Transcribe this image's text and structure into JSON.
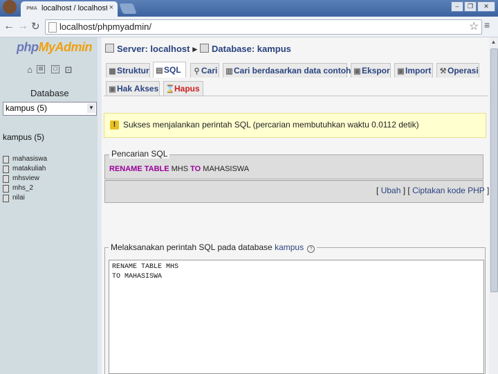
{
  "browser": {
    "tab_title": "localhost / localhost / kampus",
    "tab_favicon": "PMA",
    "tab_close": "×",
    "url": "localhost/phpmyadmin/",
    "window_buttons": [
      "–",
      "❐",
      "✕"
    ]
  },
  "logo": {
    "php": "php",
    "my": "My",
    "admin": "Admin"
  },
  "left": {
    "database_label": "Database",
    "database_selected": "kampus (5)",
    "db_heading": "kampus (5)",
    "tables": [
      "mahasiswa",
      "matakuliah",
      "mhsview",
      "mhs_2",
      "nilai"
    ]
  },
  "breadcrumb": {
    "server": "Server: localhost",
    "database": "Database: kampus",
    "arrow": "▸"
  },
  "tabs": [
    {
      "label": "Struktur"
    },
    {
      "label": "SQL"
    },
    {
      "label": "Cari"
    },
    {
      "label": "Cari berdasarkan data contoh"
    },
    {
      "label": "Ekspor"
    },
    {
      "label": "Import"
    },
    {
      "label": "Operasi"
    },
    {
      "label": "Hak Akses"
    },
    {
      "label": "Hapus"
    }
  ],
  "success_message": "Sukses menjalankan perintah SQL (percarian membutuhkan waktu 0.0112 detik)",
  "pencarian": {
    "legend": "Pencarian SQL",
    "sql_kw1": "RENAME TABLE",
    "sql_tbl1": "MHS",
    "sql_kw2": "TO",
    "sql_tbl2": "MAHASISWA"
  },
  "links": {
    "open": "[",
    "ubah": "Ubah",
    "mid": "] [",
    "php": "Ciptakan kode PHP",
    "close": "]"
  },
  "run_sql": {
    "legend_prefix": "Melaksanakan perintah SQL pada database",
    "db": "kampus",
    "help": "?",
    "query_lines": [
      "RENAME TABLE MHS",
      "TO MAHASISWA"
    ]
  },
  "colors": {
    "link": "#2a4480",
    "keyword": "#990099",
    "left_bg": "#d0dce0"
  }
}
